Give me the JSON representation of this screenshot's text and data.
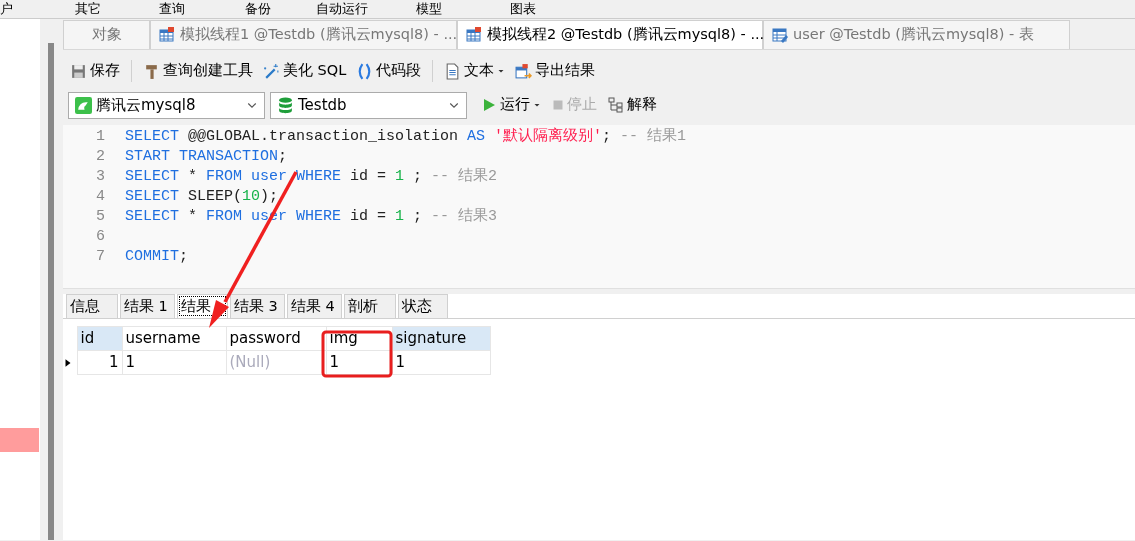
{
  "menu": [
    "户",
    "其它",
    "查询",
    "备份",
    "自动运行",
    "模型",
    "图表"
  ],
  "editor_tabs": [
    {
      "label": "对象",
      "kind": "plain",
      "selected": false
    },
    {
      "label": "模拟线程1 @Testdb (腾讯云mysql8) - ...",
      "kind": "query",
      "selected": false
    },
    {
      "label": "模拟线程2 @Testdb (腾讯云mysql8) - ...",
      "kind": "query",
      "selected": true
    },
    {
      "label": "user @Testdb (腾讯云mysql8) - 表",
      "kind": "table",
      "selected": false
    }
  ],
  "toolbar": [
    {
      "label": "保存",
      "kind": "save"
    },
    {
      "label": "查询创建工具",
      "kind": "builder"
    },
    {
      "label": "美化 SQL",
      "kind": "beautify"
    },
    {
      "label": "代码段",
      "kind": "snippet"
    },
    {
      "label": "文本",
      "kind": "text",
      "caret": true
    },
    {
      "label": "导出结果",
      "kind": "export"
    }
  ],
  "connection": "腾讯云mysql8",
  "database": "Testdb",
  "actions": [
    {
      "label": "运行",
      "kind": "run",
      "caret": true,
      "disabled": false
    },
    {
      "label": "停止",
      "kind": "stop",
      "disabled": true
    },
    {
      "label": "解释",
      "kind": "explain",
      "disabled": false
    }
  ],
  "code_lines": [
    {
      "number": "1",
      "tokens": [
        {
          "t": "SELECT",
          "kind": "keyword"
        },
        {
          "t": " @@GLOBAL.transaction_isolation ",
          "kind": "plain"
        },
        {
          "t": "AS",
          "kind": "keyword"
        },
        {
          "t": " '默认隔离级别'",
          "kind": "string"
        },
        {
          "t": "; ",
          "kind": "plain"
        },
        {
          "t": "-- 结果1",
          "kind": "comment"
        }
      ]
    },
    {
      "number": "2",
      "tokens": [
        {
          "t": "START TRANSACTION",
          "kind": "keyword"
        },
        {
          "t": ";",
          "kind": "plain"
        }
      ]
    },
    {
      "number": "3",
      "tokens": [
        {
          "t": "SELECT",
          "kind": "keyword"
        },
        {
          "t": " * ",
          "kind": "plain"
        },
        {
          "t": "FROM user WHERE",
          "kind": "keyword"
        },
        {
          "t": " id = ",
          "kind": "plain"
        },
        {
          "t": "1",
          "kind": "number"
        },
        {
          "t": " ; ",
          "kind": "plain"
        },
        {
          "t": "-- 结果2",
          "kind": "comment"
        }
      ]
    },
    {
      "number": "4",
      "tokens": [
        {
          "t": "SELECT",
          "kind": "keyword"
        },
        {
          "t": " SLEEP(",
          "kind": "plain"
        },
        {
          "t": "10",
          "kind": "number"
        },
        {
          "t": ");",
          "kind": "plain"
        }
      ]
    },
    {
      "number": "5",
      "tokens": [
        {
          "t": "SELECT",
          "kind": "keyword"
        },
        {
          "t": " * ",
          "kind": "plain"
        },
        {
          "t": "FROM user WHERE",
          "kind": "keyword"
        },
        {
          "t": " id = ",
          "kind": "plain"
        },
        {
          "t": "1",
          "kind": "number"
        },
        {
          "t": " ; ",
          "kind": "plain"
        },
        {
          "t": "-- 结果3",
          "kind": "comment"
        }
      ]
    },
    {
      "number": "6"
    },
    {
      "number": "7",
      "tokens": [
        {
          "t": "COMMIT",
          "kind": "keyword"
        },
        {
          "t": ";",
          "kind": "plain"
        }
      ]
    }
  ],
  "result_tabs": [
    {
      "label": "信息",
      "selected": false
    },
    {
      "label": "结果 1",
      "selected": false
    },
    {
      "label": "结果",
      "selected": true
    },
    {
      "label": "结果 3",
      "selected": false
    },
    {
      "label": "结果 4",
      "selected": false
    },
    {
      "label": "剖析",
      "selected": false
    },
    {
      "label": "状态",
      "selected": false
    }
  ],
  "table": {
    "columns": [
      {
        "label": "id",
        "highlighted": true
      },
      {
        "label": "username",
        "highlighted": false
      },
      {
        "label": "password",
        "highlighted": false
      },
      {
        "label": "img",
        "highlighted": false
      },
      {
        "label": "signature",
        "highlighted": true
      }
    ],
    "rows": [
      {
        "selected": true,
        "cells": [
          {
            "text": "1",
            "kind": "number"
          },
          {
            "text": "1",
            "kind": "value"
          },
          {
            "text": "(Null)",
            "kind": "null"
          },
          {
            "text": "1",
            "kind": "value"
          },
          {
            "text": "1",
            "kind": "value"
          }
        ]
      }
    ]
  },
  "annotations": {
    "arrow": true,
    "highlight_frame": true
  }
}
